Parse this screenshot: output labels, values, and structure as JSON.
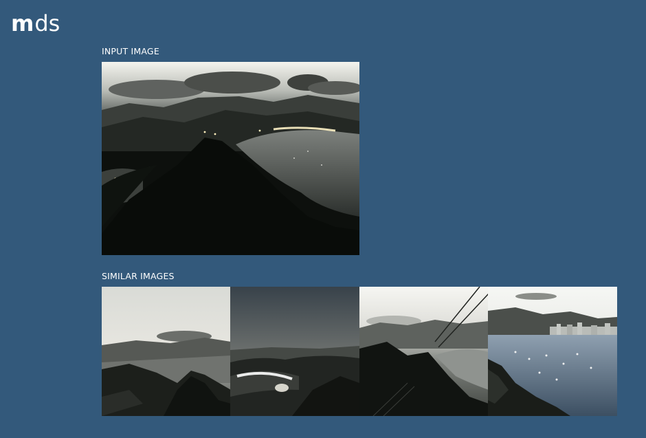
{
  "app": {
    "logo_bold": "m",
    "logo_light": "ds"
  },
  "input_section": {
    "label": "INPUT IMAGE",
    "image_icon": "aerial-night-bay-photo"
  },
  "similar_section": {
    "label": "SIMILAR IMAGES",
    "images": [
      {
        "icon": "dusk-mountain-coast-photo"
      },
      {
        "icon": "night-beach-lights-photo"
      },
      {
        "icon": "cable-car-bay-photo"
      },
      {
        "icon": "harbor-boats-city-photo"
      }
    ]
  },
  "colors": {
    "background": "#33597b",
    "text": "#ffffff"
  }
}
